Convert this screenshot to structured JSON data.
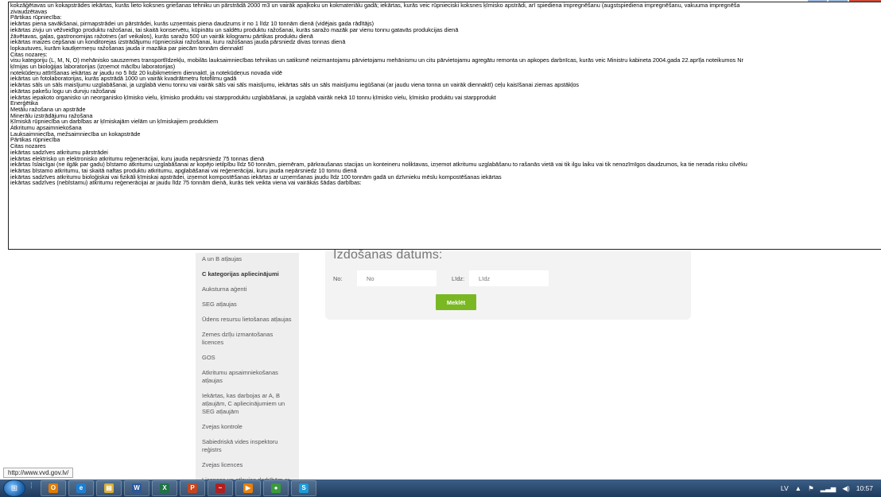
{
  "tooltip": {
    "lines": [
      "kokzāģētavas un kokapstrādes iekārtas, kurās lieto koksnes griešanas tehniku un pārstrādā 2000 m3 un vairāk apaļkoku un kokmateriālu gadā; iekārtas, kurās veic rūpnieciski koksnes ķīmisko apstrādi, arī spiediena impregnēšanu (augstspiediena impregnēšanu, vakuuma impregnēša",
      "zivaudzētavas",
      "Pārtikas rūpniecība:",
      "iekārtas piena savākšanai, pirmapstrādei un pārstrādei, kurās uzņemtais piena daudzums ir no 1 līdz 10 tonnām dienā (vidējais gada rādītājs)",
      "iekārtas zivju un vēžveidīgo produktu ražošanai, tai skaitā konservētu, kūpinātu un saldētu produktu ražošanai, kurās saražo mazāk par vienu tonnu gatavās produkcijas dienā",
      "žāvētavas, gaļas, gastronomijas ražotnes (arī veikalos), kurās saražo 500 un vairāk kilogramu pārtikas produktu dienā",
      "iekārtas maizes cepšanai un konditorejas izstrādājumu rūpnieciskai ražošanai, kuru ražošanas jauda pārsniedz divas tonnas dienā",
      "lopkautuves, kurām kautķermeņu ražošanas jauda ir mazāka par piecām tonnām diennaktī",
      "Citas nozares:",
      "visu kategoriju (L, M, N, O) mehānisko sauszemes transportlīdzekļu, mobilās lauksaimniecības tehnikas un satiksmē neizmantojamu pārvietojamu mehānismu un citu pārvietojamu agregātu remonta un apkopes darbnīcas, kurās veic Ministru kabineta 2004.gada 22.aprīļa noteikumos Nr",
      "ķīmijas un bioloģijas laboratorijas (izņemot mācību laboratorijas)",
      "notekūdeņu attīrīšanas iekārtas ar jaudu no 5 līdz 20 kubikmetriem diennaktī, ja notekūdeņus novada vidē",
      "iekārtas un fotolaboratorijas, kurās apstrādā 1000 un vairāk kvadrātmetru fotofilmu gadā",
      "iekārtas sāls un sāls maisījumu uzglabāšanai, ja uzglabā vienu tonnu vai vairāk sāls vai sāls maisījumu, iekārtas sāls un sāls maisījumu iegūšanai (ar jaudu viena tonna un vairāk diennaktī) ceļu kaisīšanai ziemas apstākļos",
      "iekārtas pakešu logu un durvju ražošanai",
      "iekārtas iepakoto organisko un neorganisko ķīmisko vielu, ķīmisko produktu vai starpproduktu uzglabāšanai, ja uzglabā vairāk nekā 10 tonnu ķīmisko vielu, ķīmisko produktu vai starpprodukt",
      "Enerģētika",
      "Metālu ražošana un apstrāde",
      "Minerālu izstrādājumu ražošana",
      "Ķīmiskā rūpniecība un darbības ar ķīmiskajām vielām un ķīmiskajiem produktiem",
      "Atkritumu apsaimniekošana",
      "Lauksaimniecība, mežsaimniecība un kokapstrāde",
      "Pārtikas rūpniecība",
      "Citas nozares",
      "iekārtas sadzīves atkritumu pārstrādei",
      "iekārtas elektrisko un elektronisko atkritumu reģenerācijai, kuru jauda nepārsniedz 75 tonnas dienā",
      "iekārtas īslaicīgai (ne ilgāk par gadu) bīstamo atkritumu uzglabāšanai ar kopējo ietilpību līdz 50 tonnām, piemēram, pārkraušanas stacijas un konteineru noliktavas, izņemot atkritumu uzglabāšanu to rašanās vietā vai tik ilgu laiku vai tik nenozīmīgos daudzumos, ka tie nerada risku cilvēku",
      "iekārtas bīstamo atkritumu, tai skaitā naftas produktu atkritumu, apglabāšanai vai reģenerācijai, kuru jauda nepārsniedz 10 tonnu dienā",
      "iekārtas sadzīves atkritumu bioloģiskai vai fizikāli ķīmiskai apstrādei, izņemot kompostēšanas iekārtas ar uzņemšanas jaudu līdz 100 tonnām gadā un dzīvnieku mēslu kompostēšanas iekārtas",
      "iekārtas sadzīves (nebīstamu) atkritumu reģenerācijai ar jaudu līdz 75 tonnām dienā, kurās tiek veikta viena vai vairākas šādas darbības:"
    ]
  },
  "sidebar": {
    "items": [
      {
        "label": "A un B atļaujas",
        "active": false
      },
      {
        "label": "C kategorijas apliecinājumi",
        "active": true
      },
      {
        "label": "Auksturna aģenti",
        "active": false
      },
      {
        "label": "SEG atļaujas",
        "active": false
      },
      {
        "label": "Ūdens resursu lietošanas atļaujas",
        "active": false
      },
      {
        "label": "Zemes dzīļu izmantošanas licences",
        "active": false
      },
      {
        "label": "GOS",
        "active": false
      },
      {
        "label": "Atkritumu apsaimniekošanas atļaujas",
        "active": false
      },
      {
        "label": "Iekārtas, kas darbojas ar A, B atļaujām, C apliecinājumiem un SEG atļaujām",
        "active": false
      },
      {
        "label": "Zvejas kontrole",
        "active": false
      },
      {
        "label": "Sabiedriskā vides inspektoru reģistrs",
        "active": false
      },
      {
        "label": "Zvejas licences",
        "active": false
      },
      {
        "label": "Licences un atļaujas darbībām ar jonizējošā starojuma avotiem",
        "active": false
      }
    ]
  },
  "form": {
    "heading": "Izdošanas datums:",
    "from_label": "No:",
    "from_placeholder": "No",
    "to_label": "Līdz:",
    "to_placeholder": "Līdz",
    "search_label": "Meklēt",
    "accent_color": "#7ab823"
  },
  "status_url": "http://www.vvd.gov.lv/",
  "taskbar": {
    "apps": [
      {
        "name": "explorer-taskbar-icon",
        "glyph": "O",
        "color": "#e07b00"
      },
      {
        "name": "internet-explorer-taskbar-icon",
        "glyph": "e",
        "color": "#1d7fd0"
      },
      {
        "name": "folder-taskbar-icon",
        "glyph": "▤",
        "color": "#d8b03a"
      },
      {
        "name": "word-taskbar-icon",
        "glyph": "W",
        "color": "#2b5797"
      },
      {
        "name": "excel-taskbar-icon",
        "glyph": "X",
        "color": "#207245"
      },
      {
        "name": "powerpoint-taskbar-icon",
        "glyph": "P",
        "color": "#c4461f"
      },
      {
        "name": "media-taskbar-icon",
        "glyph": "~",
        "color": "#b02020"
      },
      {
        "name": "vlc-taskbar-icon",
        "glyph": "▶",
        "color": "#e87f0c"
      },
      {
        "name": "chrome-taskbar-icon",
        "glyph": "●",
        "color": "#3a9a3a"
      },
      {
        "name": "skype-taskbar-icon",
        "glyph": "S",
        "color": "#1c9bd8"
      }
    ],
    "language": "LV",
    "time": "10:57"
  }
}
